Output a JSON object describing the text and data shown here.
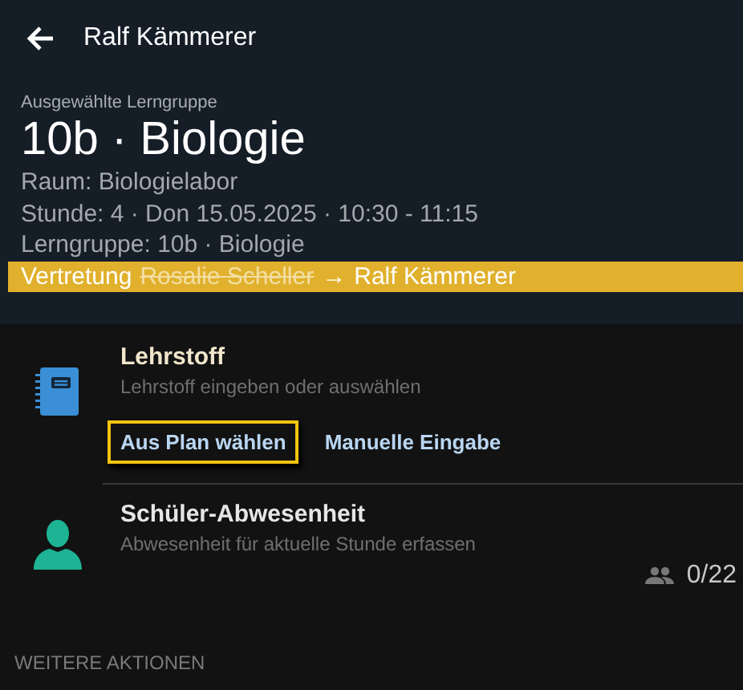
{
  "app_bar": {
    "title": "Ralf Kämmerer"
  },
  "header": {
    "caption": "Ausgewählte Lerngruppe",
    "title": "10b · Biologie",
    "details": [
      "Raum: Biologielabor",
      "Stunde: 4 · Don 15.05.2025 · 10:30 - 11:15",
      "Lerngruppe: 10b · Biologie"
    ],
    "substitution": {
      "label": "Vertretung",
      "original_teacher": "Rosalie Scheller",
      "arrow": "→",
      "substitute": "Ralf Kämmerer"
    }
  },
  "sections": [
    {
      "kind": "material",
      "title": "Lehrstoff",
      "subtitle": "Lehrstoff eingeben oder auswählen",
      "actions": [
        {
          "label": "Aus Plan wählen",
          "focused": true
        },
        {
          "label": "Manuelle Eingabe",
          "focused": false
        }
      ]
    },
    {
      "kind": "absence",
      "title": "Schüler-Abwesenheit",
      "subtitle": "Abwesenheit für aktuelle Stunde erfassen",
      "count": "0/22"
    }
  ],
  "more_heading": "WEITERE AKTIONEN"
}
